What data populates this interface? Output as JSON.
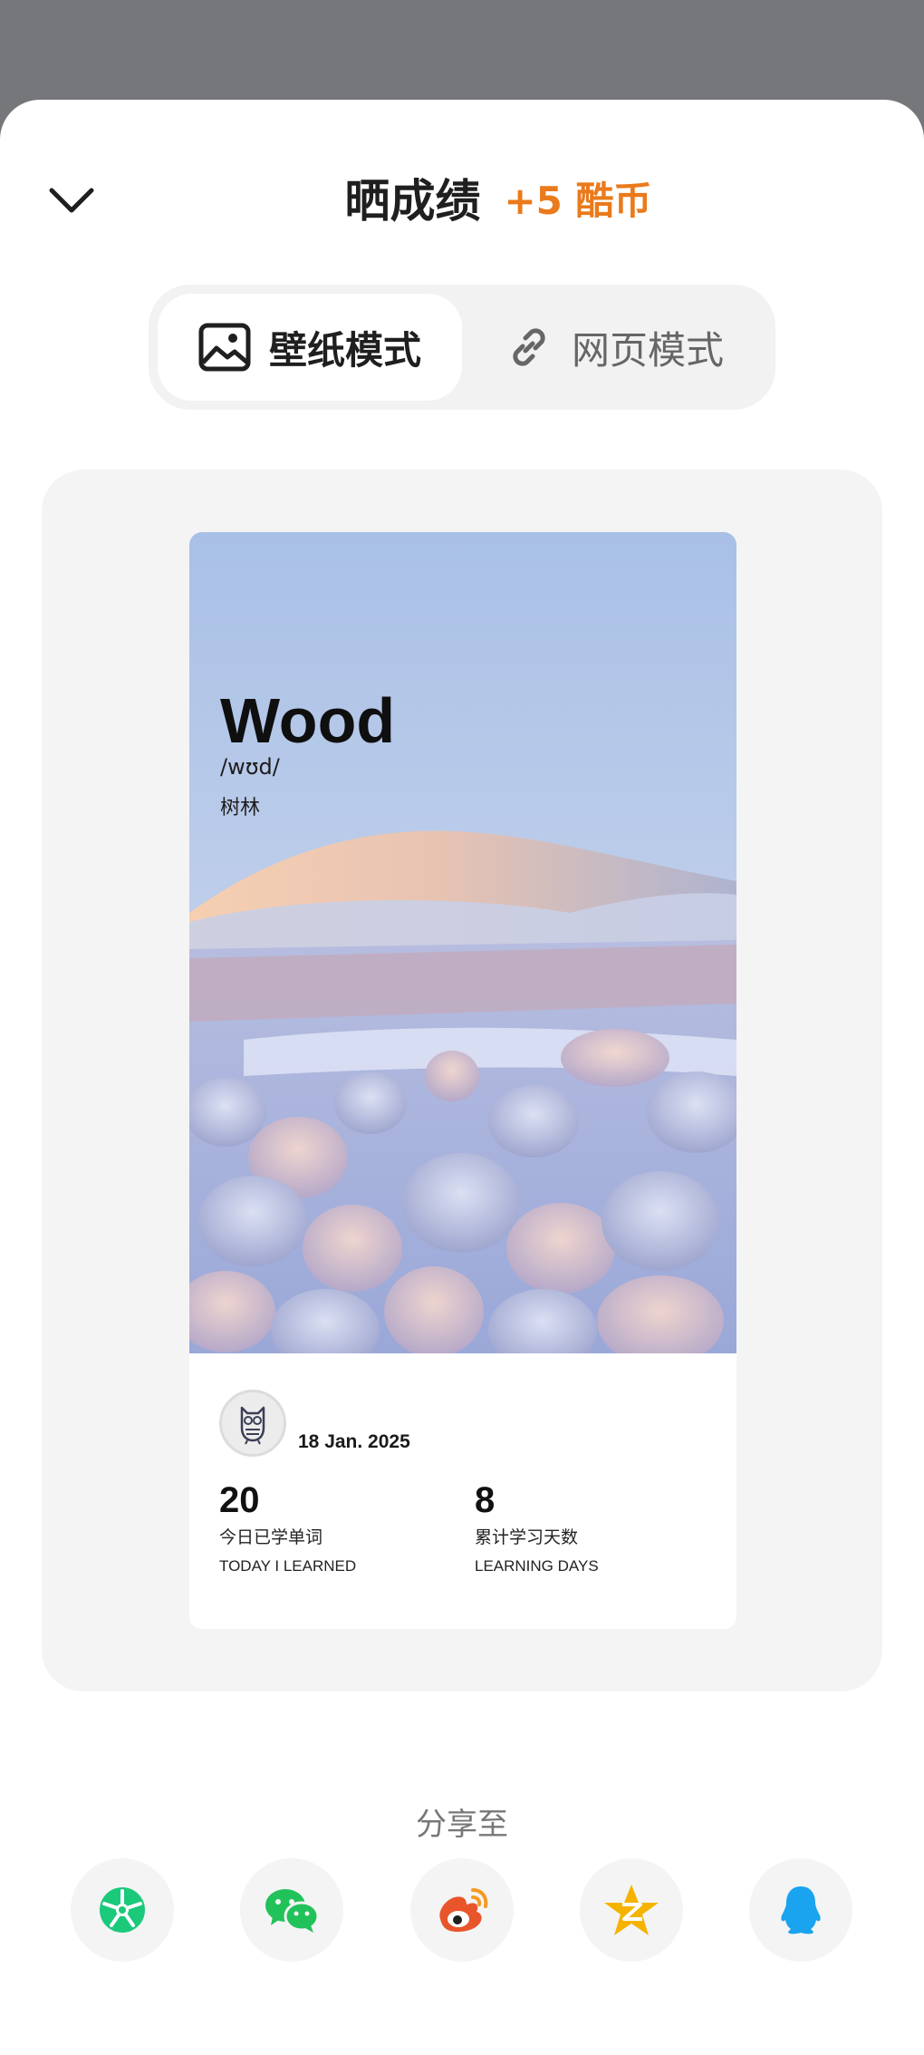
{
  "header": {
    "title": "晒成绩",
    "reward": "+5 酷币"
  },
  "mode_switch": {
    "wallpaper_label": "壁纸模式",
    "webpage_label": "网页模式",
    "active": "wallpaper"
  },
  "card": {
    "word": "Wood",
    "phonetic": "/wʊd/",
    "meaning": "树林",
    "date": "18 Jan. 2025",
    "stats": [
      {
        "number": "20",
        "label_cn": "今日已学单词",
        "label_en": "TODAY I LEARNED"
      },
      {
        "number": "8",
        "label_cn": "累计学习天数",
        "label_en": "LEARNING DAYS"
      }
    ]
  },
  "share": {
    "label": "分享至",
    "targets": [
      {
        "icon": "moments-icon",
        "color": "#1bc97b"
      },
      {
        "icon": "wechat-icon",
        "color": "#21c25a"
      },
      {
        "icon": "weibo-icon",
        "color": "#e8552b"
      },
      {
        "icon": "qzone-icon",
        "color": "#f5b300"
      },
      {
        "icon": "qq-icon",
        "color": "#1aa3ee"
      }
    ]
  }
}
